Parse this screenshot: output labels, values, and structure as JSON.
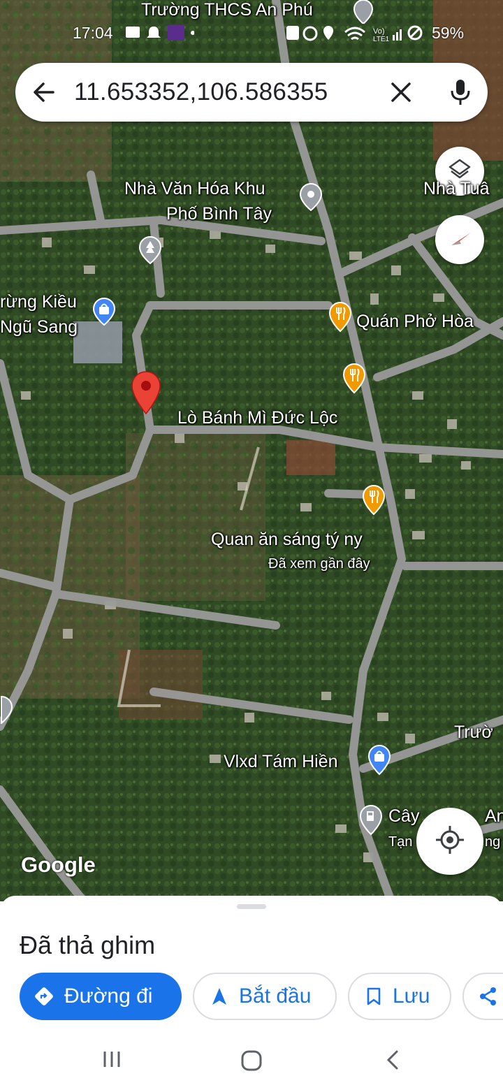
{
  "status_bar": {
    "time": "17:04",
    "battery": "59%"
  },
  "search": {
    "query": "11.653352,106.586355",
    "back_icon": "arrow-back-icon",
    "clear_icon": "close-icon",
    "mic_icon": "microphone-icon"
  },
  "map": {
    "attribution": "Google",
    "labels": {
      "school_top": "Trường THCS An Phú",
      "cultural_house_line1": "Nhà Văn Hóa Khu",
      "cultural_house_line2": "Phố Bình Tây",
      "top_right_partial": "Nhà Tuâ",
      "kieu_line1": "rừng Kiều",
      "kieu_line2": "Ngũ Sang",
      "pho_hoa": "Quán Phở Hòa",
      "banh_mi": "Lò Bánh Mì Đức Lộc",
      "quan_an": "Quan ăn sáng tý ny",
      "recently_viewed": "Đã xem gần đây",
      "vlxd": "Vlxd Tám Hiền",
      "truong_right": "Trườ",
      "cay_partial": "Cây",
      "cay_partial_right": "An",
      "tan_partial": "Tạn",
      "ng_partial": "ng"
    },
    "colors": {
      "pin": "#ea4335",
      "food_poi": "#f29900",
      "shop_poi": "#4285f4",
      "generic_poi": "#9aa0a6"
    }
  },
  "sheet": {
    "title": "Đã thả ghim",
    "buttons": {
      "directions": "Đường đi",
      "start": "Bắt đầu",
      "save": "Lưu"
    }
  },
  "theme": {
    "accent": "#1a73e8"
  }
}
